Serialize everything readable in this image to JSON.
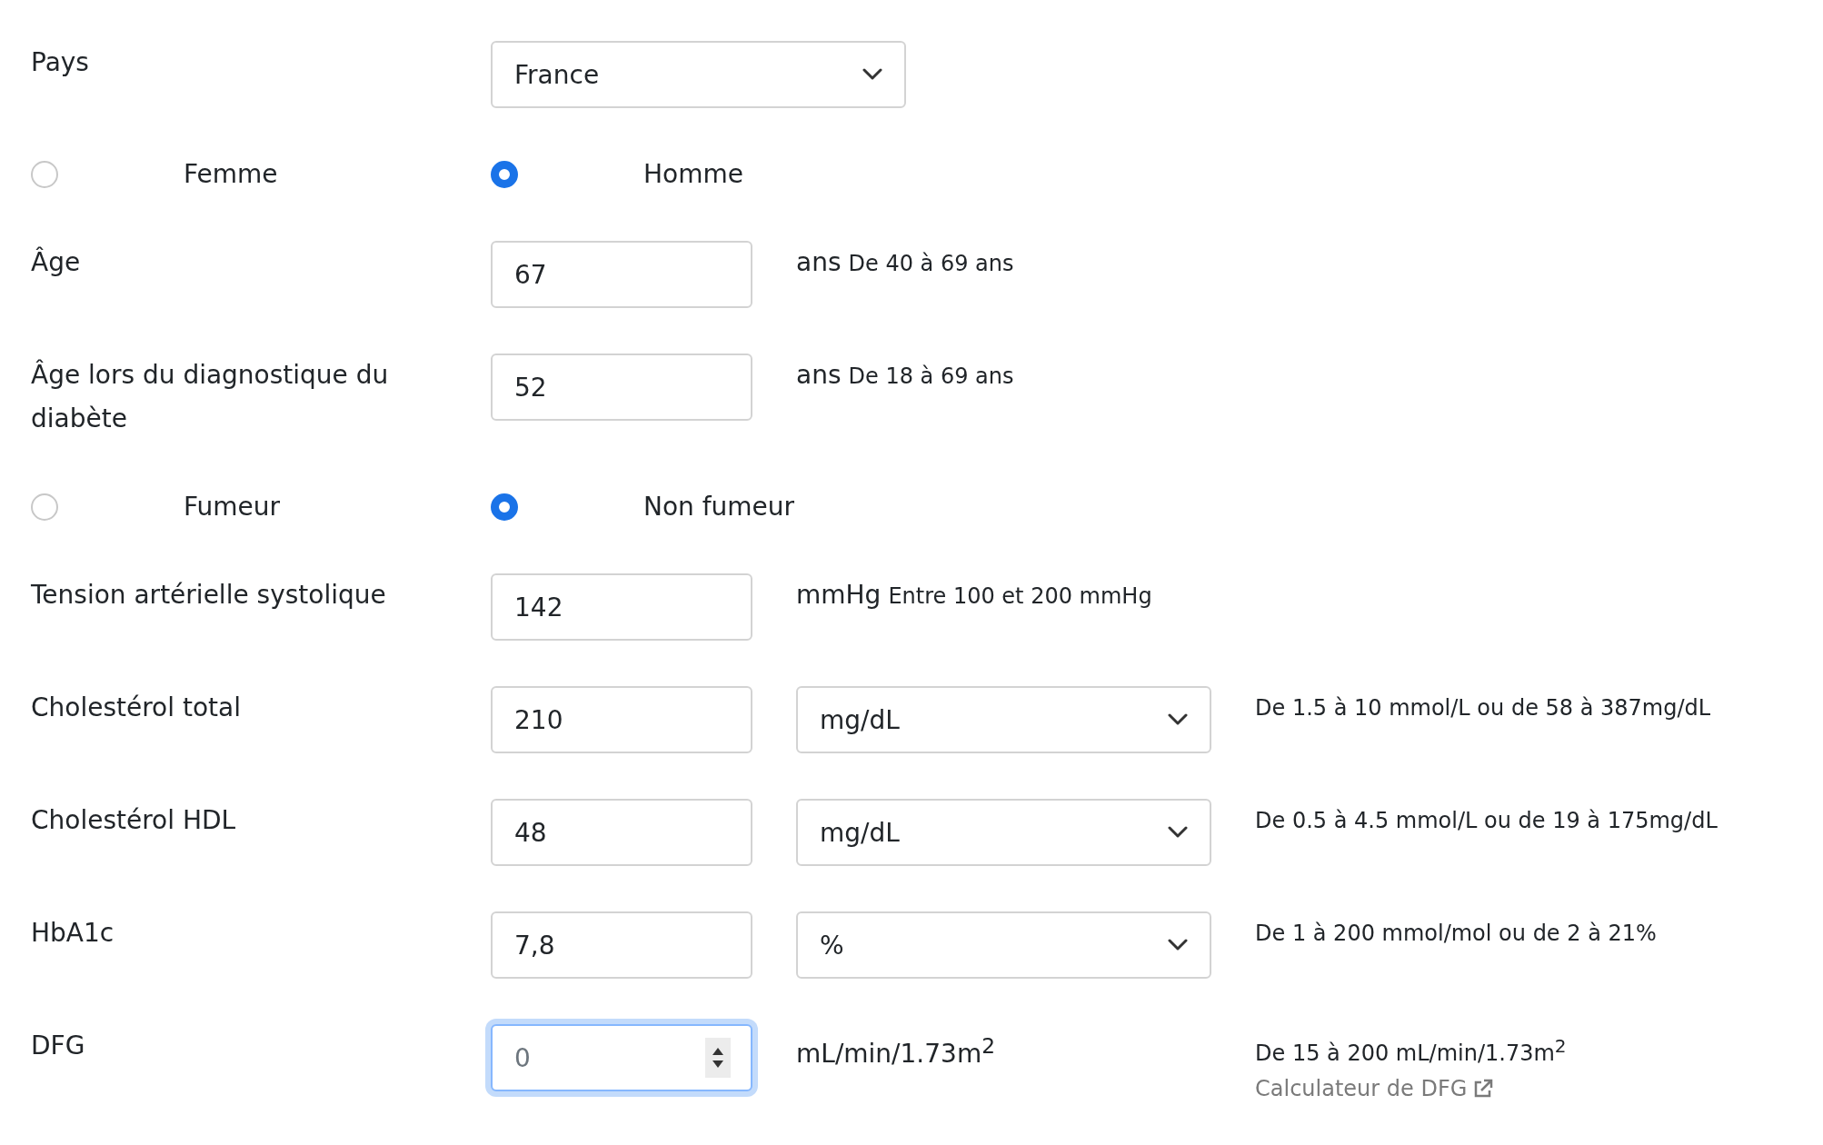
{
  "fields": [
    {
      "kind": "select",
      "label": "Pays",
      "value": "France"
    },
    {
      "kind": "radio",
      "options": [
        {
          "label": "Femme",
          "selected": false
        },
        {
          "label": "Homme",
          "selected": true
        }
      ]
    },
    {
      "kind": "input",
      "label": "Âge",
      "value": "67",
      "unit": "ans",
      "hint": "De 40 à 69 ans"
    },
    {
      "kind": "input",
      "label": "Âge lors du diagnostique du diabète",
      "value": "52",
      "unit": "ans",
      "hint": "De 18 à 69 ans"
    },
    {
      "kind": "radio",
      "options": [
        {
          "label": "Fumeur",
          "selected": false
        },
        {
          "label": "Non fumeur",
          "selected": true
        }
      ]
    },
    {
      "kind": "input",
      "label": "Tension artérielle systolique",
      "value": "142",
      "unit": "mmHg",
      "hint": "Entre 100 et 200 mmHg"
    },
    {
      "kind": "unit_select",
      "label": "Cholestérol total",
      "value": "210",
      "unit": "mg/dL",
      "hint": "De 1.5 à 10 mmol/L ou de 58 à 387mg/dL"
    },
    {
      "kind": "unit_select",
      "label": "Cholestérol HDL",
      "value": "48",
      "unit": "mg/dL",
      "hint": "De 0.5 à 4.5 mmol/L ou de 19 à 175mg/dL"
    },
    {
      "kind": "unit_select",
      "label": "HbA1c",
      "value": "7,8",
      "unit": "%",
      "hint": "De 1 à 200 mmol/mol ou de 2 à 21%"
    },
    {
      "kind": "spinner",
      "label": "DFG",
      "placeholder": "0",
      "focused": true,
      "unit": "mL/min/1.73m$^{2}$",
      "hint": "De 15 à 200 mL/min/1.73m$^{2}$",
      "link": "Calculateur de DFG"
    }
  ]
}
